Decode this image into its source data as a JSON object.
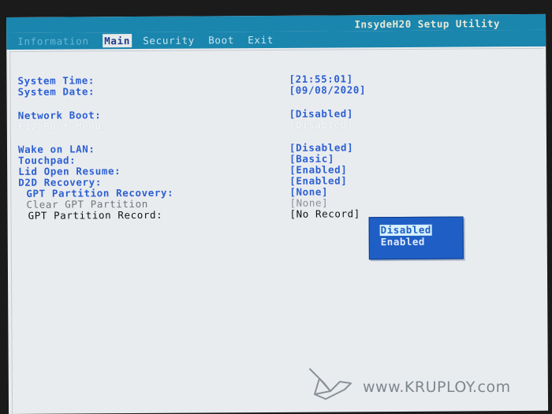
{
  "app": {
    "title": "InsydeH20 Setup Utility"
  },
  "menu": [
    {
      "label": "Information",
      "state": "faded"
    },
    {
      "label": "Main",
      "state": "active"
    },
    {
      "label": "Security",
      "state": "normal"
    },
    {
      "label": "Boot",
      "state": "normal"
    },
    {
      "label": "Exit",
      "state": "normal"
    }
  ],
  "settings": [
    {
      "label": "System Time:",
      "value": "[21:55:01]"
    },
    {
      "label": "System Date:",
      "value": "[09/08/2020]"
    },
    {
      "label": "Network Boot:",
      "value": "[Disabled]"
    },
    {
      "label": "F12 Boot Menu:",
      "value": "[Disabled]"
    },
    {
      "label": "Wake on LAN:",
      "value": "[Disabled]"
    },
    {
      "label": "Touchpad:",
      "value": "[Basic]"
    },
    {
      "label": "Lid Open Resume:",
      "value": "[Enabled]"
    },
    {
      "label": "D2D Recovery:",
      "value": "[Enabled]"
    },
    {
      "label": "GPT Partition Recovery:",
      "value": "[None]"
    },
    {
      "label": "Clear GPT Partition",
      "value": "[None]"
    },
    {
      "label": "GPT Partition Record:",
      "value": "[No Record]"
    }
  ],
  "popup": {
    "options": [
      "Disabled",
      "Enabled"
    ],
    "selected": "Disabled"
  },
  "watermark": {
    "text": "www.KRUPLOY.com"
  },
  "colors": {
    "menubar": "#1a85ad",
    "screen": "#e9ecef",
    "label_blue": "#2c5fd2",
    "popup": "#1f5fc5"
  }
}
